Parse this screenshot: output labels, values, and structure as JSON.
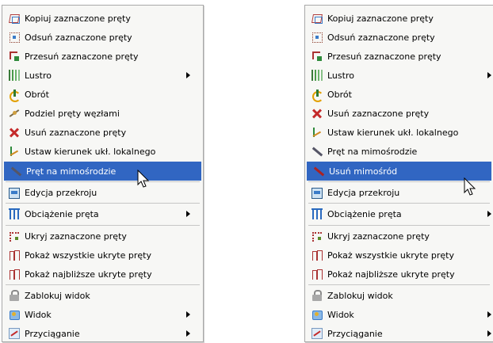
{
  "menu_left": {
    "items": [
      {
        "label": "Kopiuj zaznaczone pręty",
        "icon": "copy-bars-icon"
      },
      {
        "label": "Odsuń zaznaczone pręty",
        "icon": "offset-bars-icon"
      },
      {
        "label": "Przesuń zaznaczone pręty",
        "icon": "move-bars-icon"
      },
      {
        "label": "Lustro",
        "icon": "mirror-icon",
        "submenu": true
      },
      {
        "label": "Obrót",
        "icon": "rotate-icon"
      },
      {
        "label": "Podziel pręty węzłami",
        "icon": "divide-bars-icon"
      },
      {
        "label": "Usuń zaznaczone pręty",
        "icon": "delete-bars-icon"
      },
      {
        "label": "Ustaw kierunek ukł. lokalnego",
        "icon": "local-axis-icon"
      },
      {
        "label": "Pręt na mimośrodzie",
        "icon": "eccentric-bar-icon",
        "selected": true
      },
      {
        "label": "Edycja przekroju",
        "icon": "cross-section-icon"
      },
      {
        "label": "Obciążenie pręta",
        "icon": "bar-load-icon",
        "submenu": true
      },
      {
        "label": "Ukryj zaznaczone pręty",
        "icon": "hide-bars-icon"
      },
      {
        "label": "Pokaż wszystkie ukryte pręty",
        "icon": "show-all-bars-icon"
      },
      {
        "label": "Pokaż najbliższe ukryte pręty",
        "icon": "show-nearest-bars-icon"
      },
      {
        "label": "Zablokuj widok",
        "icon": "lock-view-icon"
      },
      {
        "label": "Widok",
        "icon": "view-icon",
        "submenu": true
      },
      {
        "label": "Przyciąganie",
        "icon": "snap-icon",
        "submenu": true
      }
    ]
  },
  "menu_right": {
    "items": [
      {
        "label": "Kopiuj zaznaczone pręty",
        "icon": "copy-bars-icon"
      },
      {
        "label": "Odsuń zaznaczone pręty",
        "icon": "offset-bars-icon"
      },
      {
        "label": "Przesuń zaznaczone pręty",
        "icon": "move-bars-icon"
      },
      {
        "label": "Lustro",
        "icon": "mirror-icon",
        "submenu": true
      },
      {
        "label": "Obrót",
        "icon": "rotate-icon"
      },
      {
        "label": "Usuń zaznaczone pręty",
        "icon": "delete-bars-icon"
      },
      {
        "label": "Ustaw kierunek ukł. lokalnego",
        "icon": "local-axis-icon"
      },
      {
        "label": "Pręt na mimośrodzie",
        "icon": "eccentric-bar-icon"
      },
      {
        "label": "Usuń mimośród",
        "icon": "remove-eccentricity-icon",
        "selected": true
      },
      {
        "label": "Edycja przekroju",
        "icon": "cross-section-icon"
      },
      {
        "label": "Obciążenie pręta",
        "icon": "bar-load-icon",
        "submenu": true
      },
      {
        "label": "Ukryj zaznaczone pręty",
        "icon": "hide-bars-icon"
      },
      {
        "label": "Pokaż wszystkie ukryte pręty",
        "icon": "show-all-bars-icon"
      },
      {
        "label": "Pokaż najbliższe ukryte pręty",
        "icon": "show-nearest-bars-icon"
      },
      {
        "label": "Zablokuj widok",
        "icon": "lock-view-icon"
      },
      {
        "label": "Widok",
        "icon": "view-icon",
        "submenu": true
      },
      {
        "label": "Przyciąganie",
        "icon": "snap-icon",
        "submenu": true
      }
    ]
  },
  "colors": {
    "selection": "#3166c2",
    "menu_background": "#f7f7f5",
    "separator": "#c6c6c6"
  }
}
